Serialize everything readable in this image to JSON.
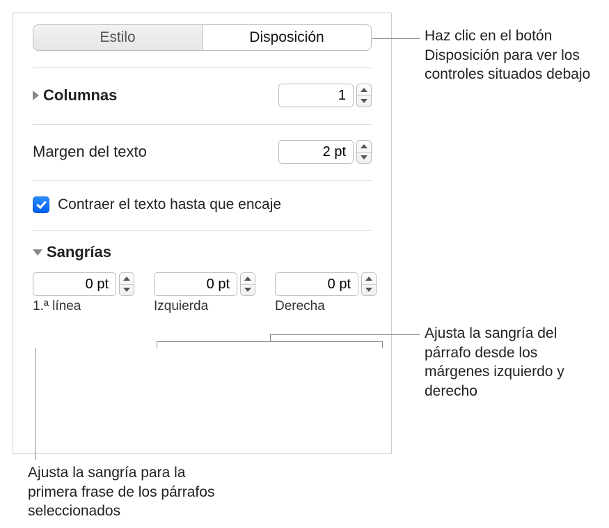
{
  "tabs": {
    "style": "Estilo",
    "layout": "Disposición"
  },
  "columns": {
    "label": "Columnas",
    "value": "1"
  },
  "textMargin": {
    "label": "Margen del texto",
    "value": "2 pt"
  },
  "shrink": {
    "label": "Contraer el texto hasta que encaje",
    "checked": true
  },
  "indents": {
    "label": "Sangrías",
    "first": {
      "value": "0 pt",
      "caption": "1.ª línea"
    },
    "left": {
      "value": "0 pt",
      "caption": "Izquierda"
    },
    "right": {
      "value": "0 pt",
      "caption": "Derecha"
    }
  },
  "callouts": {
    "layout": "Haz clic en el botón Disposición para ver los controles situados debajo",
    "lr": "Ajusta la sangría del párrafo desde los márgenes izquierdo y derecho",
    "first": "Ajusta la sangría para la primera frase de los párrafos seleccionados"
  }
}
